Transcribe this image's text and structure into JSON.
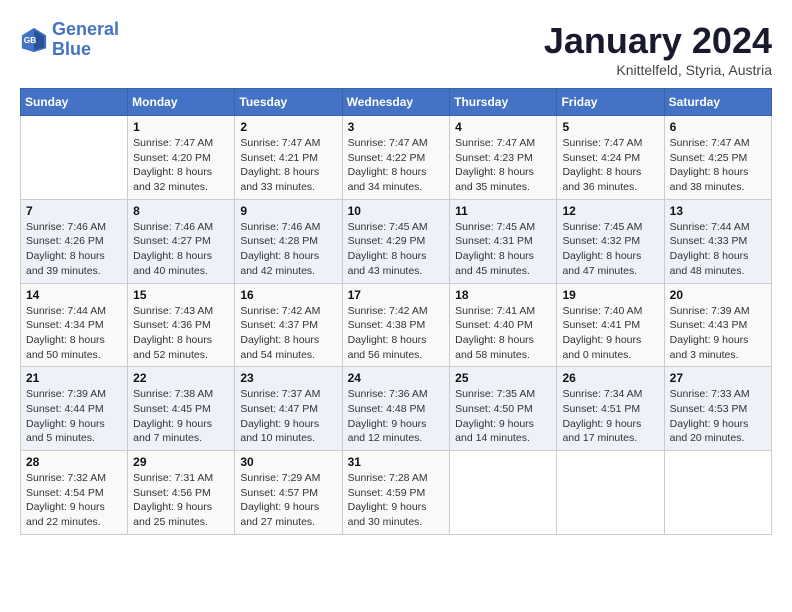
{
  "header": {
    "logo_line1": "General",
    "logo_line2": "Blue",
    "month": "January 2024",
    "location": "Knittelfeld, Styria, Austria"
  },
  "days_of_week": [
    "Sunday",
    "Monday",
    "Tuesday",
    "Wednesday",
    "Thursday",
    "Friday",
    "Saturday"
  ],
  "weeks": [
    [
      {
        "day": "",
        "sunrise": "",
        "sunset": "",
        "daylight": ""
      },
      {
        "day": "1",
        "sunrise": "Sunrise: 7:47 AM",
        "sunset": "Sunset: 4:20 PM",
        "daylight": "Daylight: 8 hours and 32 minutes."
      },
      {
        "day": "2",
        "sunrise": "Sunrise: 7:47 AM",
        "sunset": "Sunset: 4:21 PM",
        "daylight": "Daylight: 8 hours and 33 minutes."
      },
      {
        "day": "3",
        "sunrise": "Sunrise: 7:47 AM",
        "sunset": "Sunset: 4:22 PM",
        "daylight": "Daylight: 8 hours and 34 minutes."
      },
      {
        "day": "4",
        "sunrise": "Sunrise: 7:47 AM",
        "sunset": "Sunset: 4:23 PM",
        "daylight": "Daylight: 8 hours and 35 minutes."
      },
      {
        "day": "5",
        "sunrise": "Sunrise: 7:47 AM",
        "sunset": "Sunset: 4:24 PM",
        "daylight": "Daylight: 8 hours and 36 minutes."
      },
      {
        "day": "6",
        "sunrise": "Sunrise: 7:47 AM",
        "sunset": "Sunset: 4:25 PM",
        "daylight": "Daylight: 8 hours and 38 minutes."
      }
    ],
    [
      {
        "day": "7",
        "sunrise": "Sunrise: 7:46 AM",
        "sunset": "Sunset: 4:26 PM",
        "daylight": "Daylight: 8 hours and 39 minutes."
      },
      {
        "day": "8",
        "sunrise": "Sunrise: 7:46 AM",
        "sunset": "Sunset: 4:27 PM",
        "daylight": "Daylight: 8 hours and 40 minutes."
      },
      {
        "day": "9",
        "sunrise": "Sunrise: 7:46 AM",
        "sunset": "Sunset: 4:28 PM",
        "daylight": "Daylight: 8 hours and 42 minutes."
      },
      {
        "day": "10",
        "sunrise": "Sunrise: 7:45 AM",
        "sunset": "Sunset: 4:29 PM",
        "daylight": "Daylight: 8 hours and 43 minutes."
      },
      {
        "day": "11",
        "sunrise": "Sunrise: 7:45 AM",
        "sunset": "Sunset: 4:31 PM",
        "daylight": "Daylight: 8 hours and 45 minutes."
      },
      {
        "day": "12",
        "sunrise": "Sunrise: 7:45 AM",
        "sunset": "Sunset: 4:32 PM",
        "daylight": "Daylight: 8 hours and 47 minutes."
      },
      {
        "day": "13",
        "sunrise": "Sunrise: 7:44 AM",
        "sunset": "Sunset: 4:33 PM",
        "daylight": "Daylight: 8 hours and 48 minutes."
      }
    ],
    [
      {
        "day": "14",
        "sunrise": "Sunrise: 7:44 AM",
        "sunset": "Sunset: 4:34 PM",
        "daylight": "Daylight: 8 hours and 50 minutes."
      },
      {
        "day": "15",
        "sunrise": "Sunrise: 7:43 AM",
        "sunset": "Sunset: 4:36 PM",
        "daylight": "Daylight: 8 hours and 52 minutes."
      },
      {
        "day": "16",
        "sunrise": "Sunrise: 7:42 AM",
        "sunset": "Sunset: 4:37 PM",
        "daylight": "Daylight: 8 hours and 54 minutes."
      },
      {
        "day": "17",
        "sunrise": "Sunrise: 7:42 AM",
        "sunset": "Sunset: 4:38 PM",
        "daylight": "Daylight: 8 hours and 56 minutes."
      },
      {
        "day": "18",
        "sunrise": "Sunrise: 7:41 AM",
        "sunset": "Sunset: 4:40 PM",
        "daylight": "Daylight: 8 hours and 58 minutes."
      },
      {
        "day": "19",
        "sunrise": "Sunrise: 7:40 AM",
        "sunset": "Sunset: 4:41 PM",
        "daylight": "Daylight: 9 hours and 0 minutes."
      },
      {
        "day": "20",
        "sunrise": "Sunrise: 7:39 AM",
        "sunset": "Sunset: 4:43 PM",
        "daylight": "Daylight: 9 hours and 3 minutes."
      }
    ],
    [
      {
        "day": "21",
        "sunrise": "Sunrise: 7:39 AM",
        "sunset": "Sunset: 4:44 PM",
        "daylight": "Daylight: 9 hours and 5 minutes."
      },
      {
        "day": "22",
        "sunrise": "Sunrise: 7:38 AM",
        "sunset": "Sunset: 4:45 PM",
        "daylight": "Daylight: 9 hours and 7 minutes."
      },
      {
        "day": "23",
        "sunrise": "Sunrise: 7:37 AM",
        "sunset": "Sunset: 4:47 PM",
        "daylight": "Daylight: 9 hours and 10 minutes."
      },
      {
        "day": "24",
        "sunrise": "Sunrise: 7:36 AM",
        "sunset": "Sunset: 4:48 PM",
        "daylight": "Daylight: 9 hours and 12 minutes."
      },
      {
        "day": "25",
        "sunrise": "Sunrise: 7:35 AM",
        "sunset": "Sunset: 4:50 PM",
        "daylight": "Daylight: 9 hours and 14 minutes."
      },
      {
        "day": "26",
        "sunrise": "Sunrise: 7:34 AM",
        "sunset": "Sunset: 4:51 PM",
        "daylight": "Daylight: 9 hours and 17 minutes."
      },
      {
        "day": "27",
        "sunrise": "Sunrise: 7:33 AM",
        "sunset": "Sunset: 4:53 PM",
        "daylight": "Daylight: 9 hours and 20 minutes."
      }
    ],
    [
      {
        "day": "28",
        "sunrise": "Sunrise: 7:32 AM",
        "sunset": "Sunset: 4:54 PM",
        "daylight": "Daylight: 9 hours and 22 minutes."
      },
      {
        "day": "29",
        "sunrise": "Sunrise: 7:31 AM",
        "sunset": "Sunset: 4:56 PM",
        "daylight": "Daylight: 9 hours and 25 minutes."
      },
      {
        "day": "30",
        "sunrise": "Sunrise: 7:29 AM",
        "sunset": "Sunset: 4:57 PM",
        "daylight": "Daylight: 9 hours and 27 minutes."
      },
      {
        "day": "31",
        "sunrise": "Sunrise: 7:28 AM",
        "sunset": "Sunset: 4:59 PM",
        "daylight": "Daylight: 9 hours and 30 minutes."
      },
      {
        "day": "",
        "sunrise": "",
        "sunset": "",
        "daylight": ""
      },
      {
        "day": "",
        "sunrise": "",
        "sunset": "",
        "daylight": ""
      },
      {
        "day": "",
        "sunrise": "",
        "sunset": "",
        "daylight": ""
      }
    ]
  ]
}
